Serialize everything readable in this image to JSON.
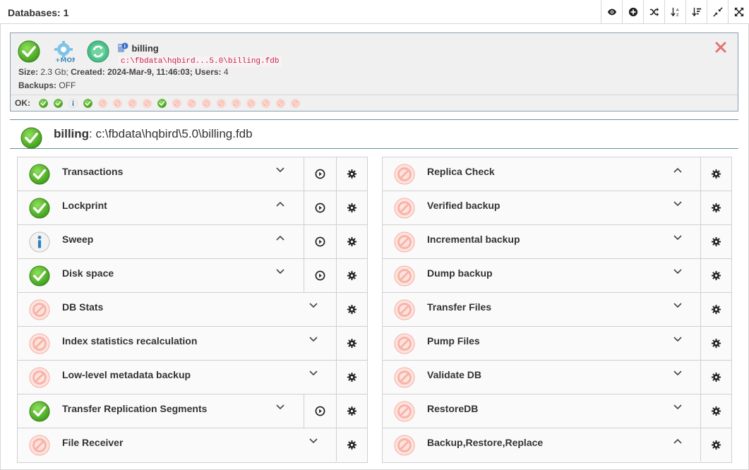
{
  "topbar": {
    "title": "Databases: 1",
    "tools": [
      {
        "icon": "eye-icon"
      },
      {
        "icon": "plus-circle-icon"
      },
      {
        "icon": "shuffle-icon"
      },
      {
        "icon": "sort-alpha-icon"
      },
      {
        "icon": "sort-amount-icon"
      },
      {
        "icon": "compress-icon"
      },
      {
        "icon": "expand-icon"
      }
    ]
  },
  "summary": {
    "db_name": "billing",
    "db_path": "c:\\fbdata\\hqbird...5.0\\billing.fdb",
    "size_label": "Size:",
    "size_value": "2.3 Gb;",
    "created_label": "Created:",
    "created_value": "2024-Mar-9, 11:46:03;",
    "users_label": "Users:",
    "users_value": "4",
    "backups_label": "Backups:",
    "backups_value": "OFF",
    "ok_label": "OK:",
    "status_dots": [
      "ok",
      "ok",
      "info",
      "ok",
      "off",
      "off",
      "off",
      "off",
      "ok",
      "off",
      "off",
      "off",
      "off",
      "off",
      "off",
      "off",
      "off",
      "off"
    ],
    "mon_badge": "+MON"
  },
  "heading": {
    "name": "billing",
    "path": ": c:\\fbdata\\hqbird\\5.0\\billing.fdb"
  },
  "left_tasks": [
    {
      "label": "Transactions",
      "status": "ok",
      "chevron": "down",
      "has_run": true
    },
    {
      "label": "Lockprint",
      "status": "ok",
      "chevron": "up",
      "has_run": true
    },
    {
      "label": "Sweep",
      "status": "info",
      "chevron": "up",
      "has_run": true
    },
    {
      "label": "Disk space",
      "status": "ok",
      "chevron": "down",
      "has_run": true
    },
    {
      "label": "DB Stats",
      "status": "off",
      "chevron": "down",
      "has_run": false
    },
    {
      "label": "Index statistics recalculation",
      "status": "off",
      "chevron": "down",
      "has_run": false
    },
    {
      "label": "Low-level metadata backup",
      "status": "off",
      "chevron": "down",
      "has_run": false
    },
    {
      "label": "Transfer Replication Segments",
      "status": "ok",
      "chevron": "down",
      "has_run": true
    },
    {
      "label": "File Receiver",
      "status": "off",
      "chevron": "down",
      "has_run": false
    }
  ],
  "right_tasks": [
    {
      "label": "Replica Check",
      "status": "off",
      "chevron": "up",
      "has_run": false
    },
    {
      "label": "Verified backup",
      "status": "off",
      "chevron": "down",
      "has_run": false
    },
    {
      "label": "Incremental backup",
      "status": "off",
      "chevron": "down",
      "has_run": false
    },
    {
      "label": "Dump backup",
      "status": "off",
      "chevron": "down",
      "has_run": false
    },
    {
      "label": "Transfer Files",
      "status": "off",
      "chevron": "down",
      "has_run": false
    },
    {
      "label": "Pump Files",
      "status": "off",
      "chevron": "down",
      "has_run": false
    },
    {
      "label": "Validate DB",
      "status": "off",
      "chevron": "down",
      "has_run": false
    },
    {
      "label": "RestoreDB",
      "status": "off",
      "chevron": "down",
      "has_run": false
    },
    {
      "label": "Backup,Restore,Replace",
      "status": "off",
      "chevron": "up",
      "has_run": false
    }
  ],
  "colors": {
    "ok_green": "#4caf23",
    "off_pink": "#f7b3a8",
    "info_blue": "#2e7fc1",
    "close_red": "#e57373",
    "card_border": "#8aa1b3",
    "path_red": "#c7254e"
  }
}
